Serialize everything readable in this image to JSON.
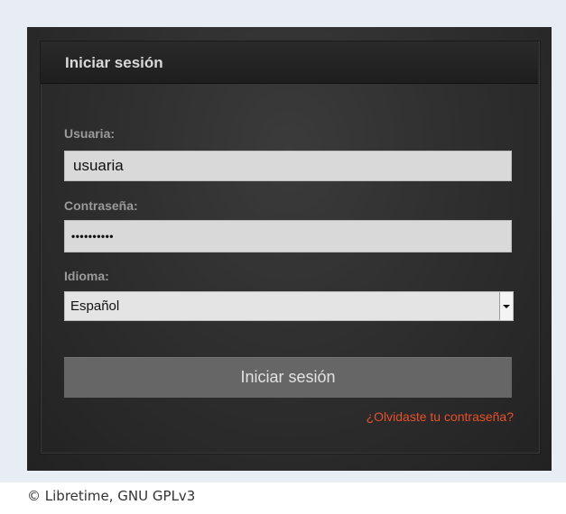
{
  "login": {
    "title": "Iniciar sesión",
    "username_label": "Usuaria:",
    "username_value": "usuaria",
    "password_label": "Contraseña:",
    "password_masked": "••••••••••",
    "language_label": "Idioma:",
    "language_selected": "Español",
    "submit_label": "Iniciar sesión",
    "forgot_link": "¿Olvidaste tu contraseña?"
  },
  "caption": "© Libretime, GNU GPLv3",
  "icons": {
    "select_arrow": "chevron-down-icon"
  },
  "colors": {
    "panel_bg": "#2f2f2f",
    "button_bg": "#666666",
    "link": "#e8502a",
    "frame_bg": "#e8edf3"
  }
}
